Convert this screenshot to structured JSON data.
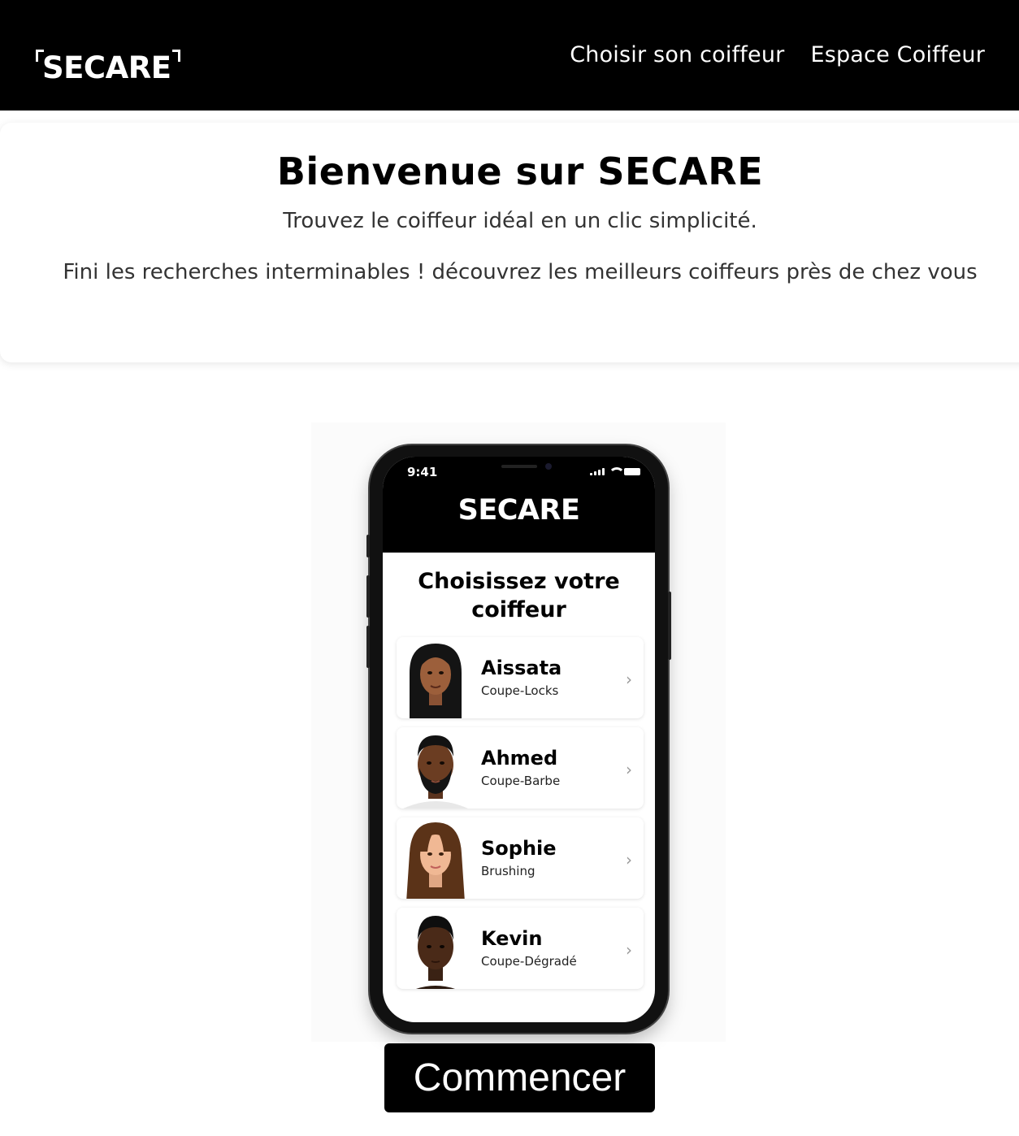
{
  "header": {
    "brand": "SECARE",
    "nav": [
      {
        "label": "Choisir son coiffeur"
      },
      {
        "label": "Espace Coiffeur"
      }
    ]
  },
  "hero": {
    "title_prefix": "Bienvenue sur ",
    "title_brand": "SECARE",
    "subtitle": "Trouvez le coiffeur idéal en un clic simplicité.",
    "tagline": "Fini les recherches interminables ! découvrez les meilleurs coiffeurs près de chez vous"
  },
  "phone": {
    "status_time": "9:41",
    "app_title": "SECARE",
    "list_heading": "Choisissez votre coiffeur",
    "hairdressers": [
      {
        "name": "Aissata",
        "service": "Coupe-Locks"
      },
      {
        "name": "Ahmed",
        "service": "Coupe-Barbe"
      },
      {
        "name": "Sophie",
        "service": "Brushing"
      },
      {
        "name": "Kevin",
        "service": "Coupe-Dégradé"
      }
    ]
  },
  "cta": {
    "label": "Commencer"
  }
}
